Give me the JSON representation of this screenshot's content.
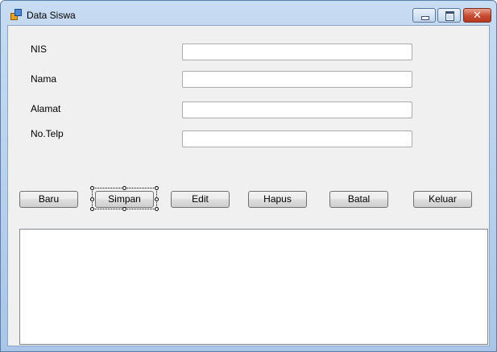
{
  "window": {
    "title": "Data Siswa",
    "close_glyph": "✕",
    "icons": {
      "app": "app-form-icon",
      "minimize": "minimize-icon",
      "maximize": "maximize-icon",
      "close": "close-icon"
    }
  },
  "form": {
    "labels": {
      "nis": "NIS",
      "nama": "Nama",
      "alamat": "Alamat",
      "telp": "No.Telp"
    },
    "values": {
      "nis": "",
      "nama": "",
      "alamat": "",
      "telp": ""
    }
  },
  "buttons": {
    "baru": "Baru",
    "simpan": "Simpan",
    "edit": "Edit",
    "hapus": "Hapus",
    "batal": "Batal",
    "keluar": "Keluar"
  },
  "colors": {
    "client_bg": "#f0f0f0",
    "titlebar": "#c7dcf2",
    "close_button": "#c64a30"
  }
}
